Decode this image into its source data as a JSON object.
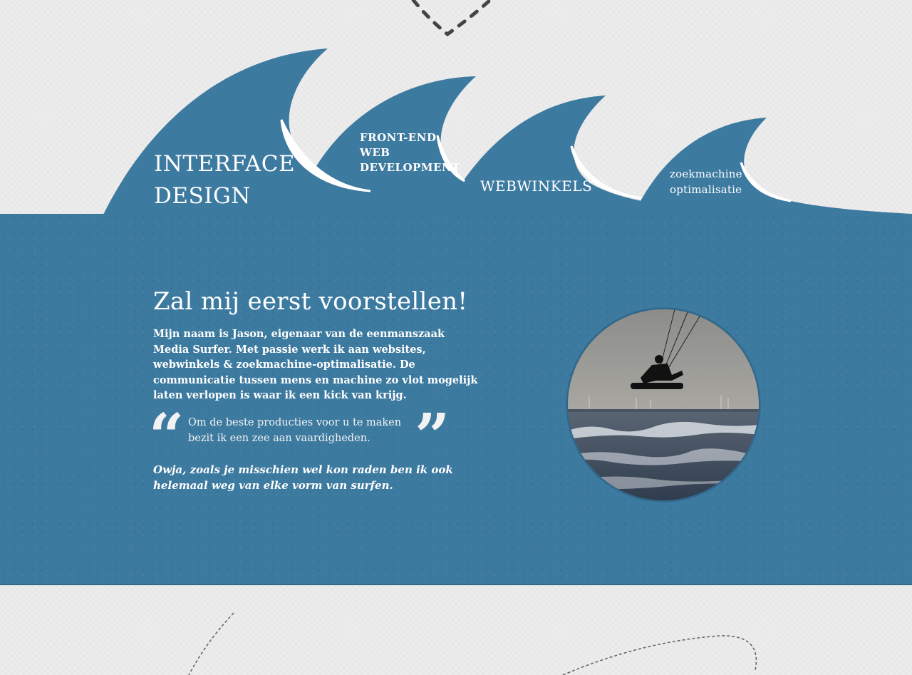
{
  "nav": {
    "interface_design": "INTERFACE\nDESIGN",
    "front_end": "FRONT-END\nWEB\nDEVELOPMENT",
    "webwinkels": "WEBWINKELS",
    "seo": "zoekmachine\noptimalisatie"
  },
  "about": {
    "heading": "Zal mij eerst voorstellen!",
    "intro": "Mijn naam is Jason, eigenaar van de eenmanszaak Media Surfer. Met passie werk ik aan websites, webwinkels & zoekmachine-optimalisatie. De communicatie tussen mens en machine zo vlot mogelijk laten verlopen is waar ik een kick van krijg.",
    "quote": "Om de beste producties voor u te maken bezit ik een zee aan vaardigheden.",
    "closing": "Owja, zoals je misschien wel kon raden ben ik ook helemaal weg van elke vorm van surfen."
  },
  "colors": {
    "sea": "#3d7aa0",
    "paper": "#ececec",
    "text": "#ffffff"
  },
  "photo": {
    "subject": "kitesurfer-photo"
  }
}
